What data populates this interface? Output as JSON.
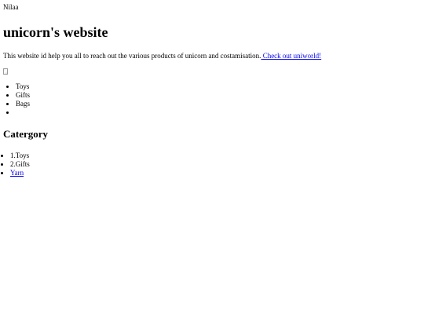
{
  "header": {
    "site_owner": "Nilaa"
  },
  "main": {
    "title": "unicorn's website",
    "intro_text": "This website id help you all to reach out the various products of unicorn and costamisation.",
    "intro_link": " Check out uniworld!",
    "image_alt": "",
    "product_list": [
      "Toys",
      "Gifts",
      "Bags",
      ""
    ],
    "category_heading": "Catergory",
    "category_list": [
      {
        "label": "1.Toys",
        "link": false
      },
      {
        "label": "2.Gifts",
        "link": false
      },
      {
        "label": "Yarn",
        "link": true
      }
    ]
  }
}
